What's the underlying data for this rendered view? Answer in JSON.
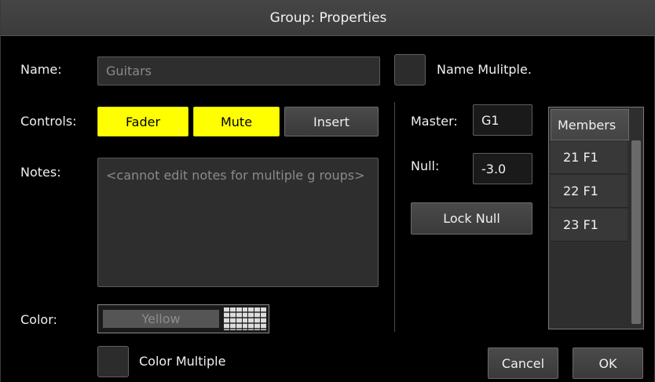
{
  "dialog": {
    "title": "Group: Properties"
  },
  "name": {
    "label": "Name:",
    "value": "Guitars",
    "name_multiple_label": "Name Mulitple."
  },
  "controls": {
    "label": "Controls:",
    "fader_label": "Fader",
    "mute_label": "Mute",
    "insert_label": "Insert",
    "fader_active": true,
    "mute_active": true,
    "insert_active": false
  },
  "notes": {
    "label": "Notes:",
    "text": "<cannot edit notes for multiple g roups>"
  },
  "color": {
    "label": "Color:",
    "value": "Yellow",
    "color_multiple_label": "Color Multiple",
    "active_color": "#ffff00"
  },
  "master": {
    "label": "Master:",
    "value": "G1"
  },
  "null": {
    "label": "Null:",
    "value": "-3.0",
    "lock_label": "Lock Null"
  },
  "members": {
    "header": "Members",
    "items": [
      "21 F1",
      "22 F1",
      "23 F1"
    ]
  },
  "footer": {
    "cancel_label": "Cancel",
    "ok_label": "OK"
  },
  "colors": {
    "background": "#000000",
    "title_bar": "#404040",
    "field": "#2e2e2e",
    "accent_yellow": "#ffff00"
  }
}
